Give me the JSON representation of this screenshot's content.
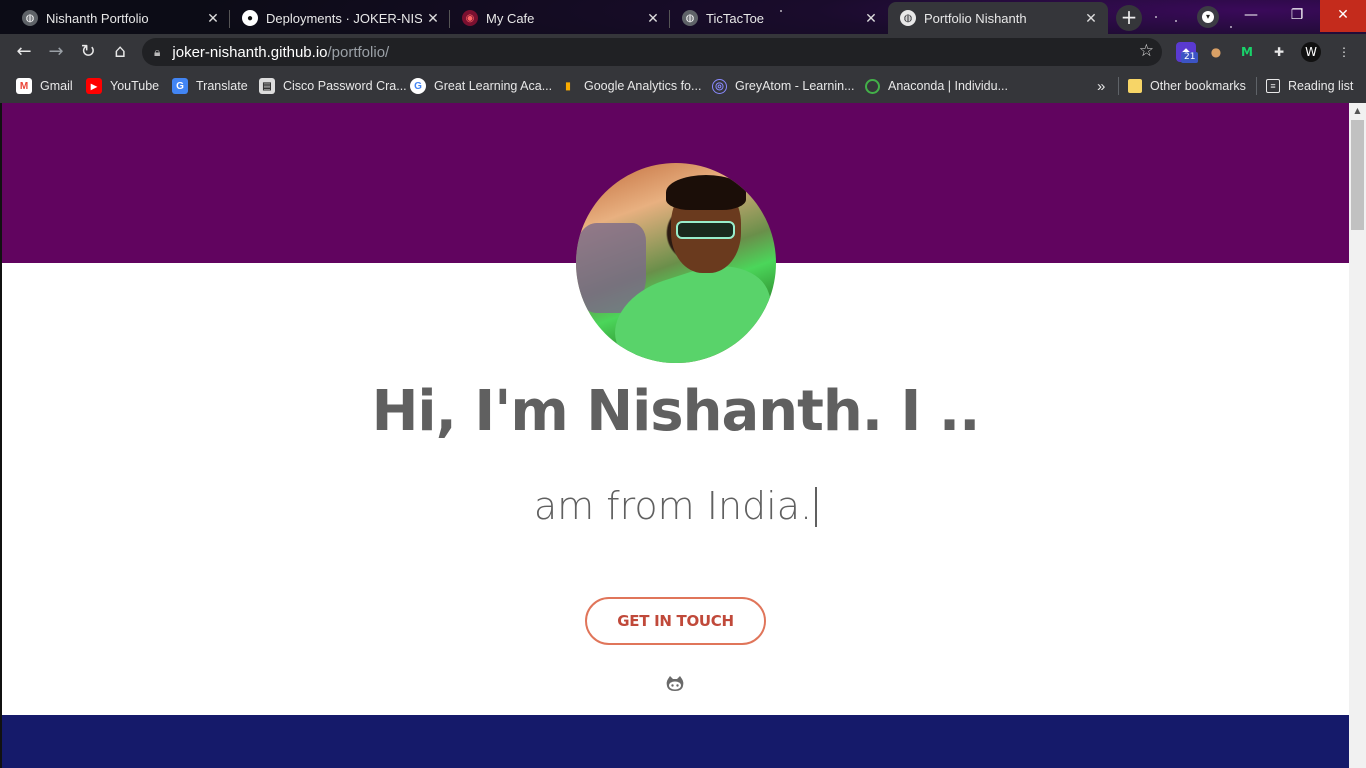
{
  "tabs": [
    {
      "title": "Nishanth Portfolio",
      "icon": "globe-icon",
      "active": false
    },
    {
      "title": "Deployments · JOKER-NISHANTH",
      "icon": "github-icon",
      "active": false
    },
    {
      "title": "My Cafe",
      "icon": "cafe-icon",
      "active": false
    },
    {
      "title": "TicTacToe",
      "icon": "globe-icon",
      "active": false
    },
    {
      "title": "Portfolio Nishanth",
      "icon": "globe-icon",
      "active": true
    }
  ],
  "omnibox": {
    "host": "joker-nishanth.github.io",
    "path": "/portfolio/"
  },
  "extensions": {
    "badge": "21"
  },
  "bookmarks": [
    {
      "label": "Gmail",
      "icon": "gmail-icon",
      "color": "#ea4335"
    },
    {
      "label": "YouTube",
      "icon": "youtube-icon",
      "color": "#ff0000"
    },
    {
      "label": "Translate",
      "icon": "translate-icon",
      "color": "#4285f4"
    },
    {
      "label": "Cisco Password Cra...",
      "icon": "cisco-icon",
      "color": "#cccccc"
    },
    {
      "label": "Great Learning Aca...",
      "icon": "google-icon",
      "color": "#ffffff"
    },
    {
      "label": "Google Analytics fo...",
      "icon": "analytics-icon",
      "color": "#f9ab00"
    },
    {
      "label": "GreyAtom - Learnin...",
      "icon": "greyatom-icon",
      "color": "#8a8aff"
    },
    {
      "label": "Anaconda | Individu...",
      "icon": "anaconda-icon",
      "color": "#43b049"
    }
  ],
  "bookmarks_overflow": "»",
  "other_bookmarks": "Other bookmarks",
  "reading_list": "Reading list",
  "page": {
    "headline": "Hi, I'm Nishanth. I ..",
    "typed_text": "am from India.",
    "cta_label": "GET IN TOUCH",
    "hero_color": "#61045f",
    "footer_color": "#151a6a",
    "accent": "#e0755a"
  }
}
